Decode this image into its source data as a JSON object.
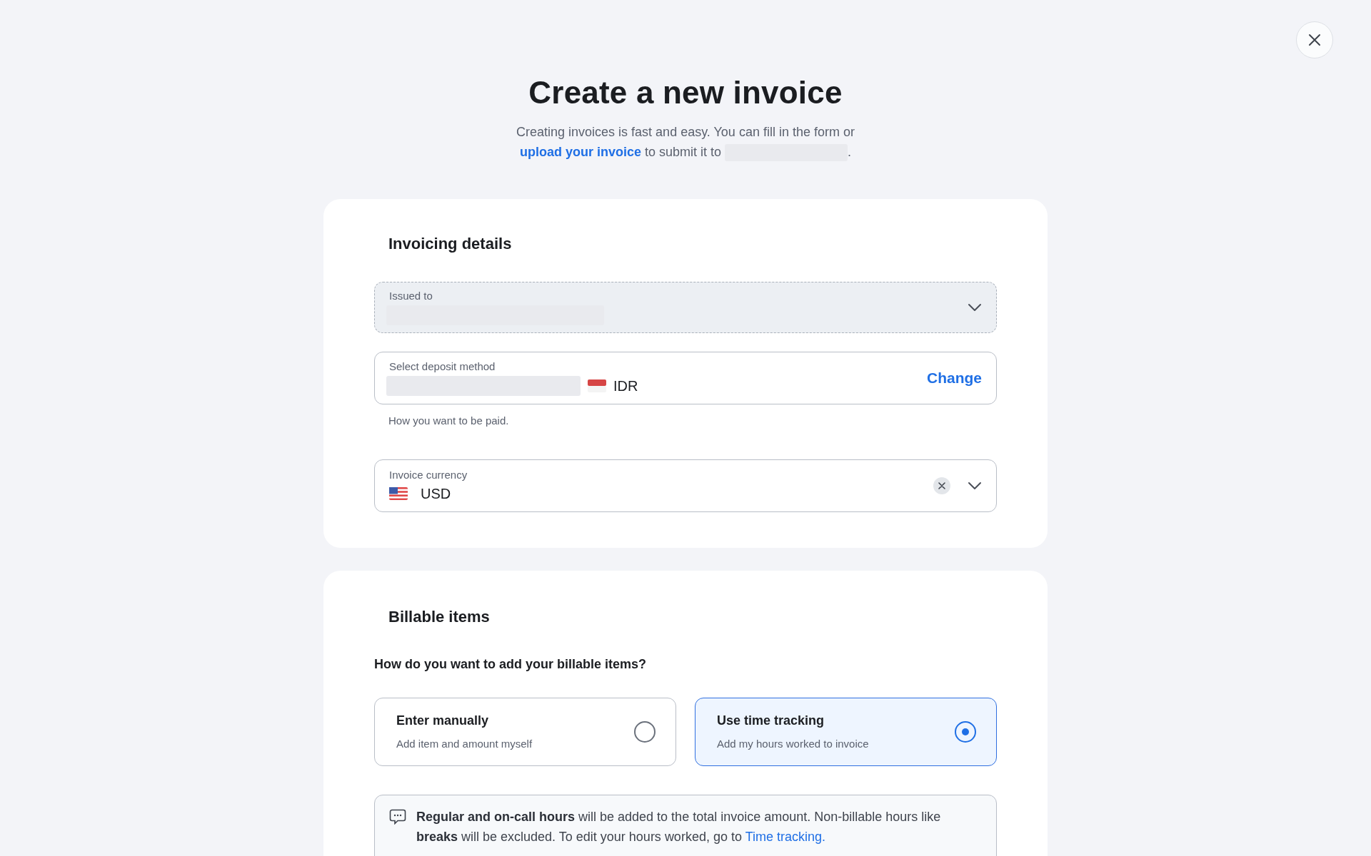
{
  "header": {
    "title": "Create a new invoice",
    "subtitle_parts": [
      {
        "kind": "text",
        "text": "Creating invoices is fast and easy. You can fill in the form or "
      },
      {
        "kind": "link",
        "text": "upload your invoice"
      },
      {
        "kind": "text",
        "text": " to submit it to "
      },
      {
        "kind": "redacted"
      },
      {
        "kind": "text",
        "text": "."
      }
    ]
  },
  "invoicing_details": {
    "title": "Invoicing details",
    "fields": [
      {
        "kind": "select",
        "label": "Issued to",
        "redacted": true,
        "disabled": true
      },
      {
        "kind": "deposit",
        "label": "Select deposit method",
        "redacted": true,
        "value": "IDR",
        "action": "Change",
        "hint": "How you want to be paid."
      },
      {
        "kind": "currency",
        "label": "Invoice currency",
        "value": "USD",
        "clearable": true
      }
    ]
  },
  "billable_items": {
    "title": "Billable items",
    "question": "How do you want to add your billable items?",
    "options": [
      {
        "title": "Enter manually",
        "description": "Add item and amount myself",
        "selected": false
      },
      {
        "title": "Use time tracking",
        "description": "Add my hours worked to invoice",
        "selected": true
      }
    ],
    "info": {
      "text": "**Regular and on-call hours** will be added to the total invoice amount. Non-billable hours like **breaks** will be excluded. To edit your hours worked, go to ",
      "link": "Time tracking."
    }
  }
}
